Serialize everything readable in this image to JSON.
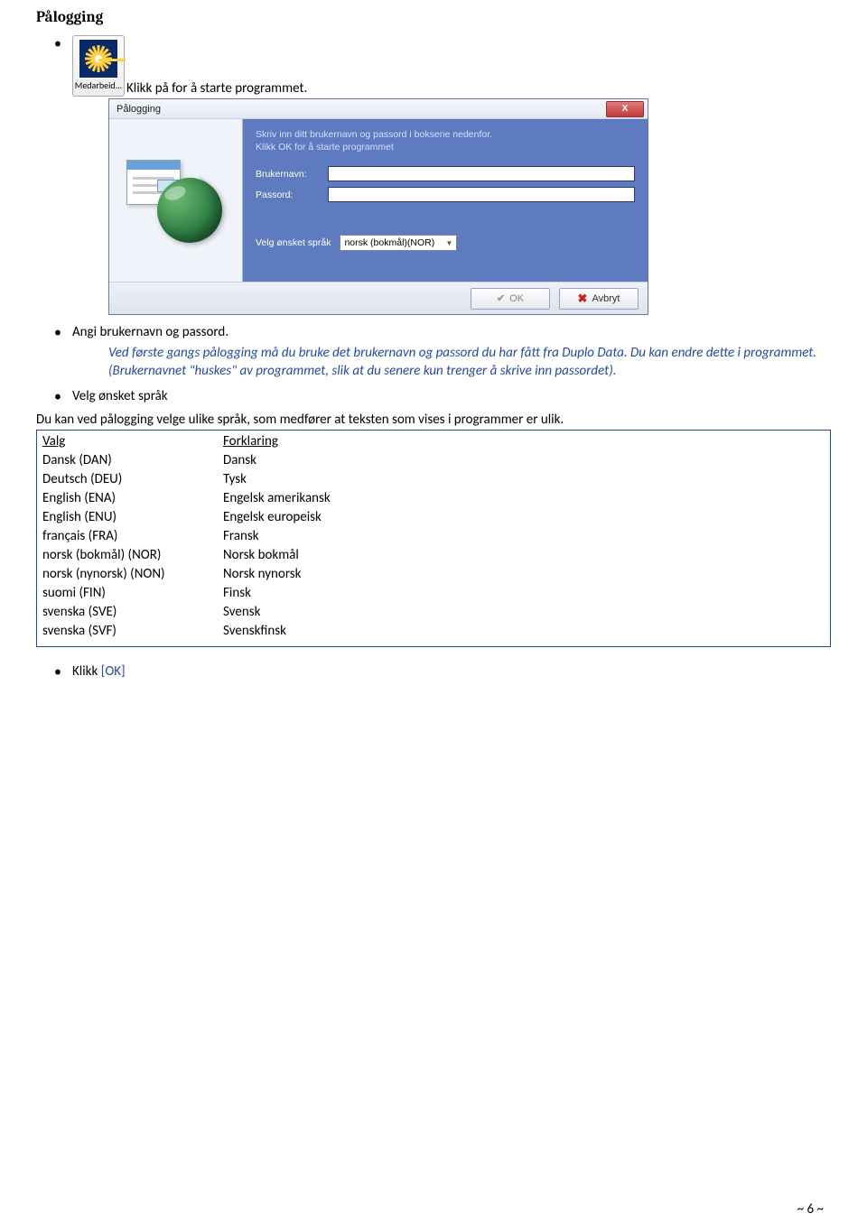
{
  "heading": "Pålogging",
  "icon_label": "Medarbeid...",
  "bullets": {
    "start": "Klikk på for å starte programmet.",
    "enter_creds": "Angi brukernavn og passord.",
    "select_lang": "Velg ønsket språk",
    "klikk_prefix": "Klikk ",
    "klikk_ok": "[OK]"
  },
  "desc": {
    "line1": "Ved første gangs pålogging må du bruke det brukernavn og passord du har fått fra Duplo Data. Du kan endre dette i programmet. (Brukernavnet \"huskes\" av programmet, slik at du senere kun trenger å skrive inn passordet)."
  },
  "lang_note": "Du kan ved pålogging velge ulike språk, som medfører at teksten som vises i programmer er ulik.",
  "dialog": {
    "title": "Pålogging",
    "instr1": "Skriv inn ditt brukernavn og passord i boksene nedenfor.",
    "instr2": "Klikk OK for å starte programmet",
    "user_label": "Brukernavn:",
    "pass_label": "Passord:",
    "lang_label": "Velg ønsket språk",
    "lang_value": "norsk (bokmål)(NOR)",
    "ok_label": "OK",
    "cancel_label": "Avbryt"
  },
  "table": {
    "header1": "Valg",
    "header2": "Forklaring",
    "rows": [
      {
        "c1": "Dansk (DAN)",
        "c2": "Dansk"
      },
      {
        "c1": "Deutsch (DEU)",
        "c2": "Tysk"
      },
      {
        "c1": "English (ENA)",
        "c2": "Engelsk amerikansk"
      },
      {
        "c1": "English (ENU)",
        "c2": "Engelsk europeisk"
      },
      {
        "c1": "français (FRA)",
        "c2": "Fransk"
      },
      {
        "c1": "norsk (bokmål) (NOR)",
        "c2": "Norsk bokmål"
      },
      {
        "c1": "norsk (nynorsk) (NON)",
        "c2": "Norsk nynorsk"
      },
      {
        "c1": "suomi (FIN)",
        "c2": "Finsk"
      },
      {
        "c1": "svenska (SVE)",
        "c2": "Svensk"
      },
      {
        "c1": "svenska (SVF)",
        "c2": "Svenskfinsk"
      }
    ]
  },
  "page_number": "~ 6 ~"
}
